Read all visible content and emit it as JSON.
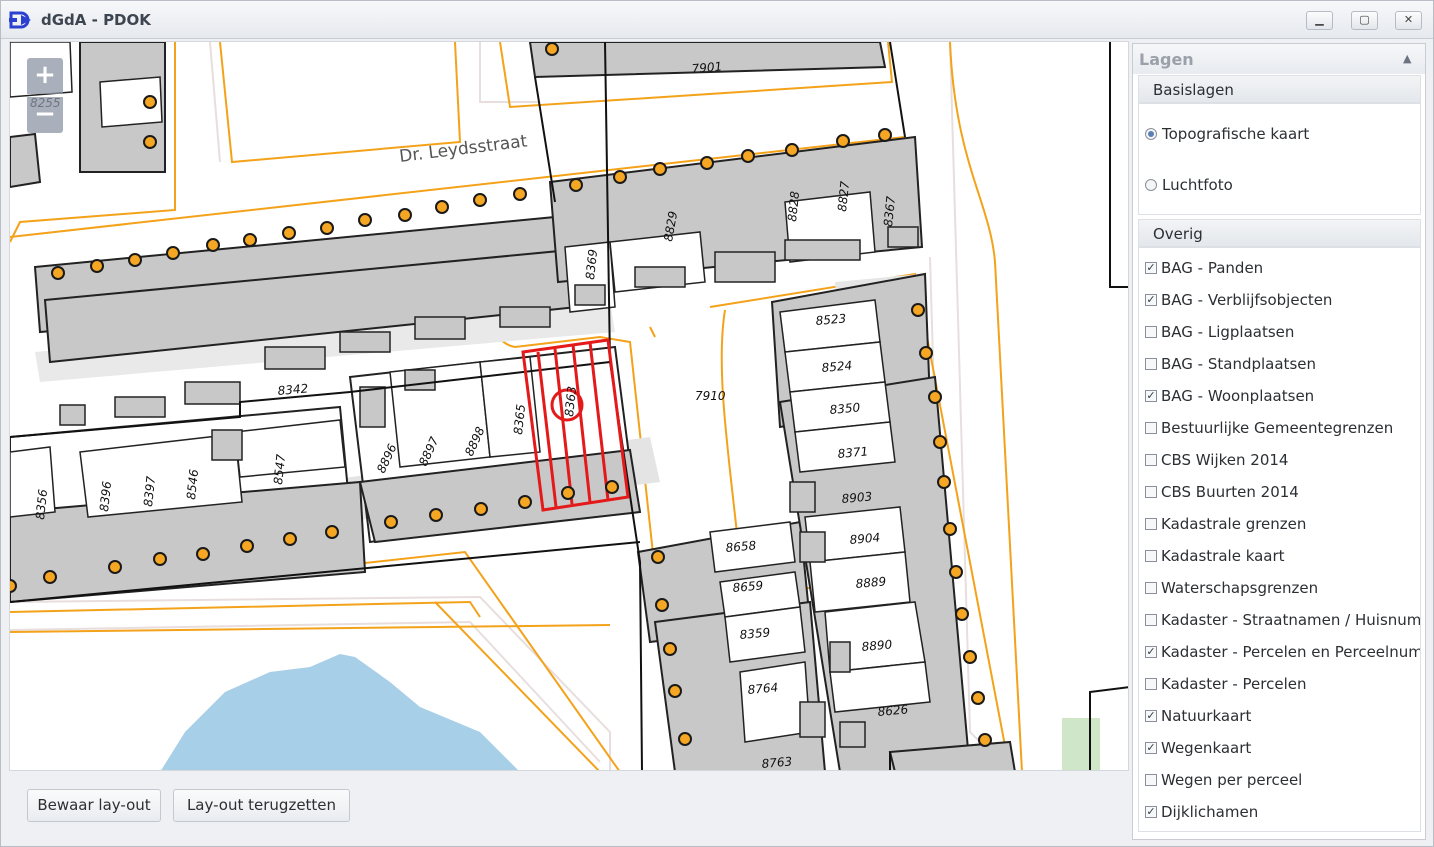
{
  "window": {
    "title": "dGdA - PDOK",
    "minimize_symbol": "▁",
    "maximize_symbol": "▢",
    "close_symbol": "✕",
    "logo_icon": "dgda-logo-icon"
  },
  "map": {
    "zoom_in": "+",
    "zoom_out": "−",
    "street_name": "Dr. Leydsstraat",
    "house_numbers": [
      "8255",
      "7901",
      "8829",
      "8828",
      "8827",
      "8367",
      "8369",
      "8342",
      "7910",
      "8523",
      "8524",
      "8350",
      "8371",
      "8903",
      "8904",
      "8889",
      "8890",
      "8626",
      "8658",
      "8659",
      "8359",
      "8764",
      "8763",
      "8356",
      "8396",
      "8397",
      "8546",
      "8547",
      "8896",
      "8897",
      "8898",
      "8365",
      "8363"
    ],
    "colors": {
      "parcel_orange": "#f3a21a",
      "building_gray": "#c8c8c8",
      "water_blue": "#a8cfe8",
      "selection_red": "#e41a1a",
      "address_dot": "#f5a623"
    }
  },
  "bottom": {
    "save_layout": "Bewaar lay-out",
    "reset_layout": "Lay-out terugzetten"
  },
  "layers": {
    "title": "Lagen",
    "pin_icon": "pin-icon",
    "base_group": "Basislagen",
    "base_layers": [
      {
        "label": "Topografische kaart",
        "selected": true
      },
      {
        "label": "Luchtfoto",
        "selected": false
      }
    ],
    "other_group": "Overig",
    "other_layers": [
      {
        "label": "BAG - Panden",
        "checked": true
      },
      {
        "label": "BAG - Verblijfsobjecten",
        "checked": true
      },
      {
        "label": "BAG - Ligplaatsen",
        "checked": false
      },
      {
        "label": "BAG - Standplaatsen",
        "checked": false
      },
      {
        "label": "BAG - Woonplaatsen",
        "checked": true
      },
      {
        "label": "Bestuurlijke Gemeentegrenzen",
        "checked": false
      },
      {
        "label": "CBS Wijken 2014",
        "checked": false
      },
      {
        "label": "CBS Buurten 2014",
        "checked": false
      },
      {
        "label": "Kadastrale grenzen",
        "checked": false
      },
      {
        "label": "Kadastrale kaart",
        "checked": false
      },
      {
        "label": "Waterschapsgrenzen",
        "checked": false
      },
      {
        "label": "Kadaster - Straatnamen / Huisnummers",
        "checked": false
      },
      {
        "label": "Kadaster - Percelen en Perceelnummers",
        "checked": true
      },
      {
        "label": "Kadaster - Percelen",
        "checked": false
      },
      {
        "label": "Natuurkaart",
        "checked": true
      },
      {
        "label": "Wegenkaart",
        "checked": true
      },
      {
        "label": "Wegen per perceel",
        "checked": false
      },
      {
        "label": "Dijklichamen",
        "checked": true
      }
    ]
  }
}
